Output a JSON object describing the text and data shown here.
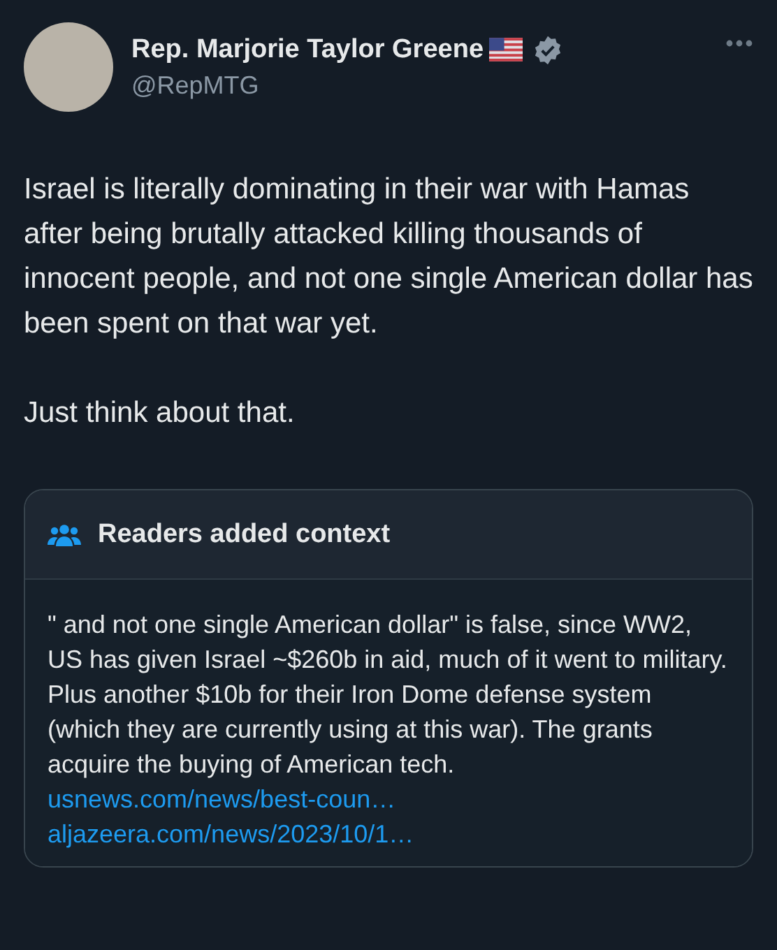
{
  "author": {
    "name": "Rep. Marjorie Taylor Greene",
    "handle": "@RepMTG",
    "verified": true
  },
  "paragraphs": [
    "Israel is literally dominating in their war with Hamas after being brutally attacked killing thousands of innocent people, and not one single American dollar has been spent on that war yet.",
    "Just think about that."
  ],
  "context_note": {
    "title": "Readers added context",
    "body": "\" and not one single American dollar\" is false, since WW2, US has given Israel ~$260b in aid, much of it went to military. Plus another $10b for their Iron Dome defense system (which they are currently using at this war). The grants acquire the buying of American tech.",
    "links": [
      "usnews.com/news/best-coun…",
      "aljazeera.com/news/2023/10/1…"
    ]
  }
}
